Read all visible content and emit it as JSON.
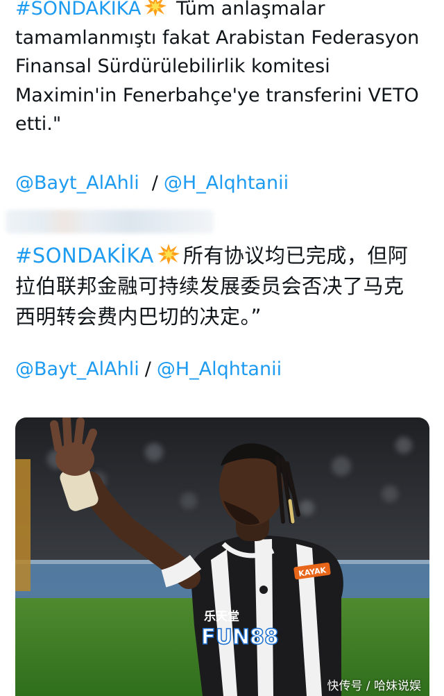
{
  "tweet": {
    "turkish": {
      "hashtag": "#SONDAKİKA",
      "emoji": "collision-emoji",
      "text": " Tüm anlaşmalar tamamlanmıştı fakat Arabistan Federasyon Finansal Sürdürülebilirlik komitesi Maximin'in Fenerbahçe'ye transferini VETO etti.\""
    },
    "mentions_1": {
      "first": "@Bayt_AlAhli",
      "separator": "/",
      "second": "@H_Alqhtanii"
    },
    "chinese": {
      "hashtag": "#SONDAKİKA",
      "emoji": "collision-emoji",
      "text": "所有协议均已完成，但阿拉伯联邦金融可持续发展委员会否决了马克西明转会费内巴切的决定。”"
    },
    "mentions_2": {
      "first": "@Bayt_AlAhli",
      "separator": "/",
      "second": "@H_Alqhtanii"
    }
  },
  "photo": {
    "alt_subject": "footballer-in-striped-kit",
    "sponsor": "FUN88",
    "sponsor_cn": "乐天堂",
    "sleeve": "KAYAK",
    "watermark": "快传号 / 哈妹说娱"
  },
  "colors": {
    "link": "#1d9bf0",
    "text": "#0f1419",
    "background": "#ffffff"
  }
}
